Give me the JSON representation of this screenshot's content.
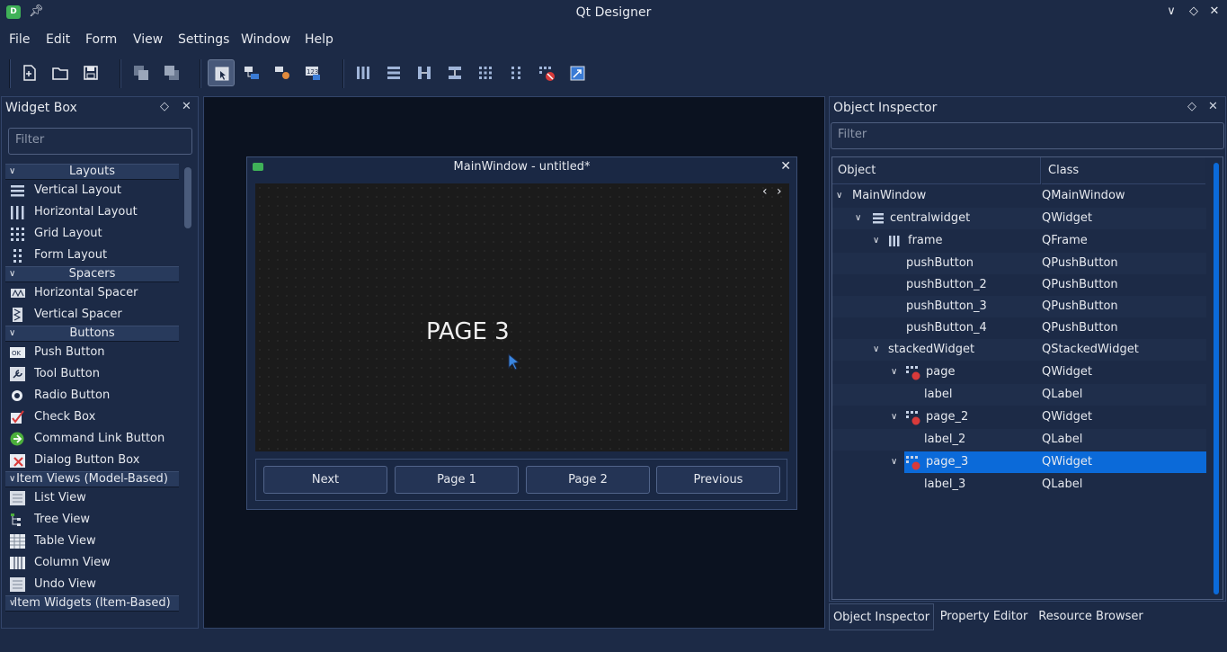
{
  "window": {
    "title": "Qt Designer",
    "app_icon": "D"
  },
  "menu": [
    "File",
    "Edit",
    "Form",
    "View",
    "Settings",
    "Window",
    "Help"
  ],
  "widget_box": {
    "title": "Widget Box",
    "filter_placeholder": "Filter",
    "sections": [
      {
        "label": "Layouts",
        "items": [
          "Vertical Layout",
          "Horizontal Layout",
          "Grid Layout",
          "Form Layout"
        ]
      },
      {
        "label": "Spacers",
        "items": [
          "Horizontal Spacer",
          "Vertical Spacer"
        ]
      },
      {
        "label": "Buttons",
        "items": [
          "Push Button",
          "Tool Button",
          "Radio Button",
          "Check Box",
          "Command Link Button",
          "Dialog Button Box"
        ]
      },
      {
        "label": "Item Views (Model-Based)",
        "items": [
          "List View",
          "Tree View",
          "Table View",
          "Column View",
          "Undo View"
        ]
      },
      {
        "label": "Item Widgets (Item-Based)",
        "items": []
      }
    ]
  },
  "form": {
    "title": "MainWindow - untitled*",
    "page_label": "PAGE 3",
    "buttons": [
      "Next",
      "Page 1",
      "Page 2",
      "Previous"
    ]
  },
  "object_inspector": {
    "title": "Object Inspector",
    "filter_placeholder": "Filter",
    "columns": [
      "Object",
      "Class"
    ],
    "rows": [
      {
        "object": "MainWindow",
        "class": "QMainWindow"
      },
      {
        "object": "centralwidget",
        "class": "QWidget"
      },
      {
        "object": "frame",
        "class": "QFrame"
      },
      {
        "object": "pushButton",
        "class": "QPushButton"
      },
      {
        "object": "pushButton_2",
        "class": "QPushButton"
      },
      {
        "object": "pushButton_3",
        "class": "QPushButton"
      },
      {
        "object": "pushButton_4",
        "class": "QPushButton"
      },
      {
        "object": "stackedWidget",
        "class": "QStackedWidget"
      },
      {
        "object": "page",
        "class": "QWidget"
      },
      {
        "object": "label",
        "class": "QLabel"
      },
      {
        "object": "page_2",
        "class": "QWidget"
      },
      {
        "object": "label_2",
        "class": "QLabel"
      },
      {
        "object": "page_3",
        "class": "QWidget",
        "selected": true
      },
      {
        "object": "label_3",
        "class": "QLabel"
      }
    ]
  },
  "bottom_tabs": [
    "Object Inspector",
    "Property Editor",
    "Resource Browser"
  ],
  "colors": {
    "accent": "#0b6ad9",
    "background": "#1c2a46",
    "canvas": "#0b1220"
  }
}
